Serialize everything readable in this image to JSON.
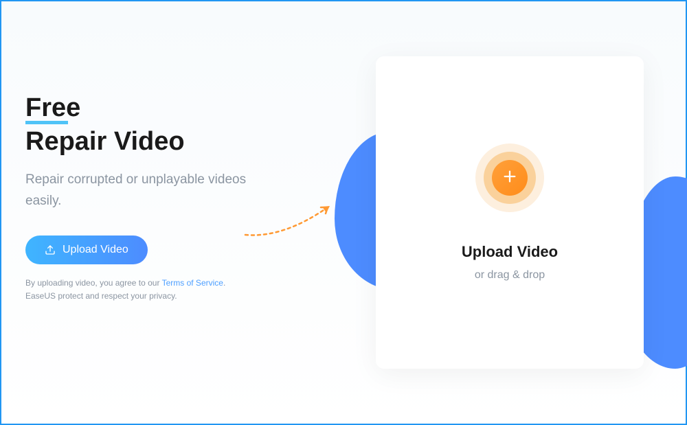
{
  "hero": {
    "title_free": "Free",
    "title_repair": "Repair Video",
    "subtitle": "Repair corrupted or unplayable videos easily."
  },
  "upload_button": {
    "label": "Upload Video"
  },
  "agreement": {
    "prefix": "By uploading video, you agree to our ",
    "terms_link": "Terms of Service",
    "suffix": ".",
    "privacy": "EaseUS protect and respect your privacy."
  },
  "upload_card": {
    "title": "Upload Video",
    "subtitle": "or drag & drop"
  },
  "colors": {
    "accent_blue": "#4d8cff",
    "accent_orange": "#ff8c1a",
    "text_muted": "#8b95a1"
  }
}
